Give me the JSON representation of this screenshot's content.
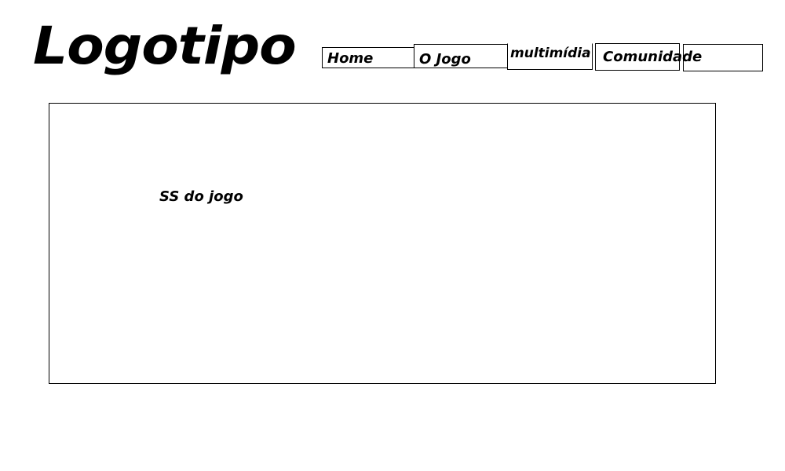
{
  "header": {
    "logo_text": "Logotipo"
  },
  "nav": {
    "home": "Home",
    "o_jogo": "O Jogo",
    "multimidia": "multimídia",
    "comunidade": "Comunidade",
    "blank": ""
  },
  "main": {
    "screenshot_label": "SS do jogo"
  }
}
